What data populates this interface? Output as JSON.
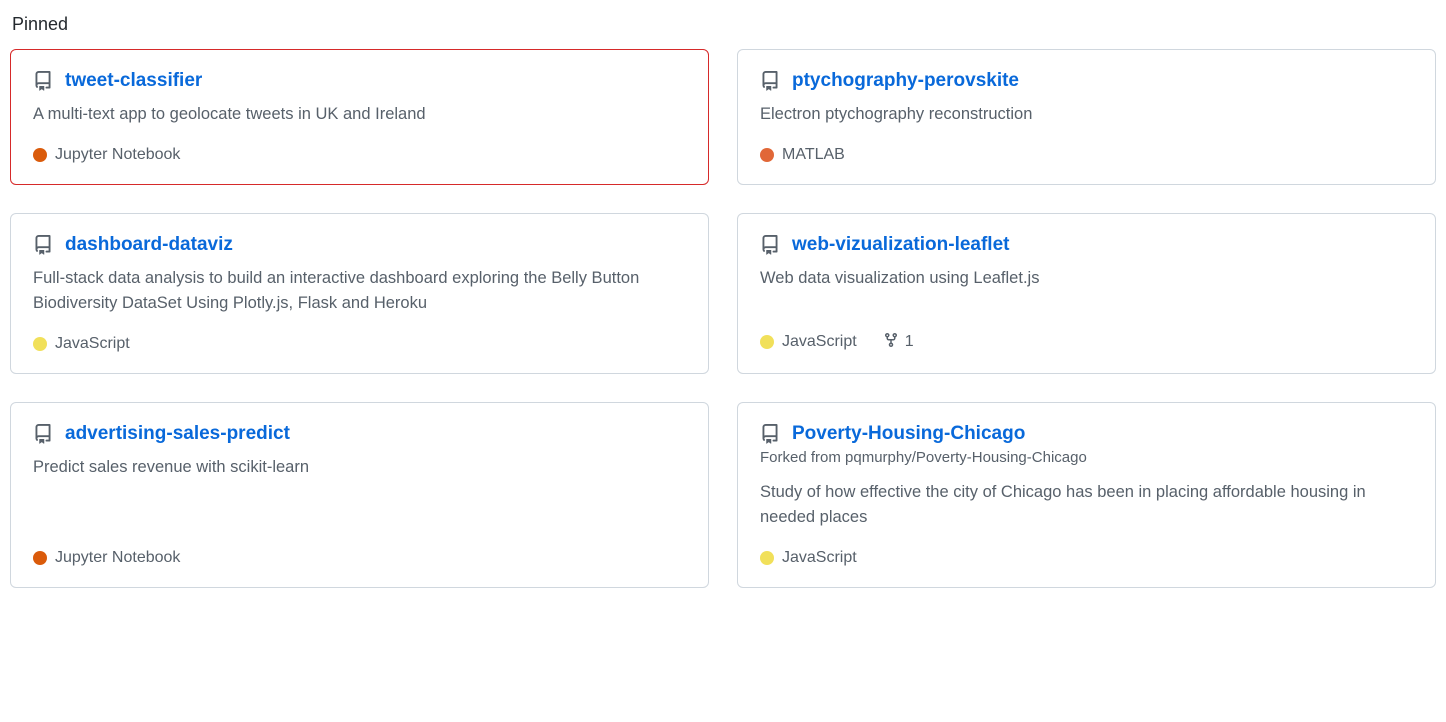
{
  "section_title": "Pinned",
  "language_colors": {
    "Jupyter Notebook": "#DA5B0B",
    "MATLAB": "#e16737",
    "JavaScript": "#f1e05a"
  },
  "repos": [
    {
      "name": "tweet-classifier",
      "description": "A multi-text app to geolocate tweets in UK and Ireland",
      "language": "Jupyter Notebook",
      "highlight": true
    },
    {
      "name": "ptychography-perovskite",
      "description": "Electron ptychography reconstruction",
      "language": "MATLAB"
    },
    {
      "name": "dashboard-dataviz",
      "description": "Full-stack data analysis to build an interactive dashboard exploring the Belly Button Biodiversity DataSet Using Plotly.js, Flask and Heroku",
      "language": "JavaScript"
    },
    {
      "name": "web-vizualization-leaflet",
      "description": "Web data visualization using Leaflet.js",
      "language": "JavaScript",
      "forks": "1"
    },
    {
      "name": "advertising-sales-predict",
      "description": "Predict sales revenue with scikit-learn",
      "language": "Jupyter Notebook"
    },
    {
      "name": "Poverty-Housing-Chicago",
      "forked_from": "Forked from pqmurphy/Poverty-Housing-Chicago",
      "description": "Study of how effective the city of Chicago has been in placing affordable housing in needed places",
      "language": "JavaScript"
    }
  ]
}
